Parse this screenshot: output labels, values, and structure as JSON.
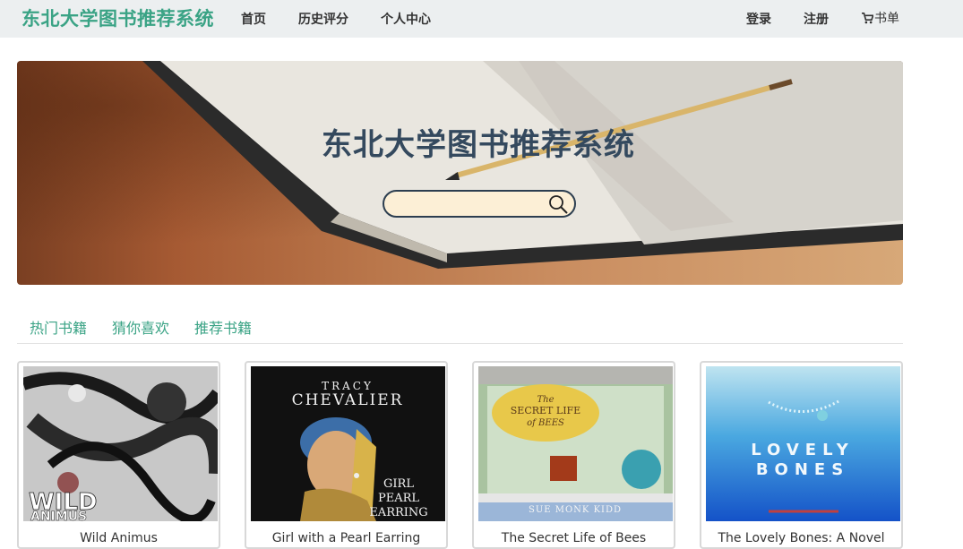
{
  "navbar": {
    "brand": "东北大学图书推荐系统",
    "links": [
      "首页",
      "历史评分",
      "个人中心"
    ],
    "login": "登录",
    "register": "注册",
    "cart_label": "书单"
  },
  "hero": {
    "title": "东北大学图书推荐系统",
    "search_placeholder": ""
  },
  "tabs": [
    "热门书籍",
    "猜你喜欢",
    "推荐书籍"
  ],
  "books": [
    {
      "title": "Wild Animus",
      "cover_text": [
        "WILD",
        "ANIMUS"
      ]
    },
    {
      "title": "Girl with a Pearl Earring",
      "cover_text": [
        "TRACY",
        "CHEVALIER",
        "GIRL",
        "PEARL",
        "EARRING"
      ]
    },
    {
      "title": "The Secret Life of Bees",
      "cover_text": [
        "The",
        "SECRET LIFE",
        "of BEES",
        "SUE MONK KIDD"
      ]
    },
    {
      "title": "The Lovely Bones: A Novel",
      "cover_text": [
        "LOVELY",
        "BONES"
      ]
    }
  ],
  "colors": {
    "accent": "#3aa385",
    "navbar_bg": "#eceff0",
    "hero_title": "#34495e",
    "search_bg": "#fcefd6"
  }
}
